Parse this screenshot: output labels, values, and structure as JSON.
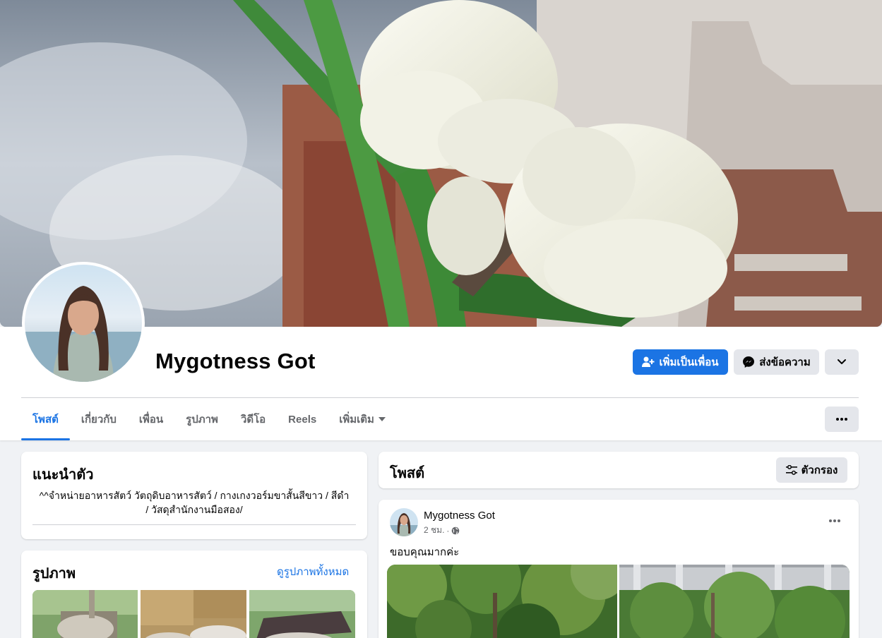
{
  "profile": {
    "name": "Mygotness Got"
  },
  "actions": {
    "add_friend_label": "เพิ่มเป็นเพื่อน",
    "message_label": "ส่งข้อความ"
  },
  "tabs": [
    {
      "label": "โพสต์",
      "active": true
    },
    {
      "label": "เกี่ยวกับ"
    },
    {
      "label": "เพื่อน"
    },
    {
      "label": "รูปภาพ"
    },
    {
      "label": "วิดีโอ"
    },
    {
      "label": "Reels"
    },
    {
      "label": "เพิ่มเติม"
    }
  ],
  "intro": {
    "title": "แนะนำตัว",
    "bio_line1": "^^จำหน่ายอาหารสัตว์ วัตถุดิบอาหารสัตว์ / กางเกงวอร์มขาสั้นสีขาว / สีดำ",
    "bio_line2": "/ วัสดุสำนักงานมือสอง/"
  },
  "photos": {
    "title": "รูปภาพ",
    "see_all": "ดูรูปภาพทั้งหมด"
  },
  "posts_header": {
    "title": "โพสต์",
    "filter_label": "ตัวกรอง"
  },
  "post": {
    "author": "Mygotness Got",
    "time": "2 ชม.",
    "separator": "·",
    "text": "ขอบคุณมากค่ะ"
  },
  "colors": {
    "accent": "#1b74e4",
    "page_bg": "#f0f2f5"
  },
  "icons": {
    "add_friend": "person-plus-icon",
    "message": "messenger-icon",
    "dropdown": "chevron-down-icon",
    "more": "more-horizontal-icon",
    "filter": "filter-sliders-icon",
    "privacy": "globe-icon"
  }
}
